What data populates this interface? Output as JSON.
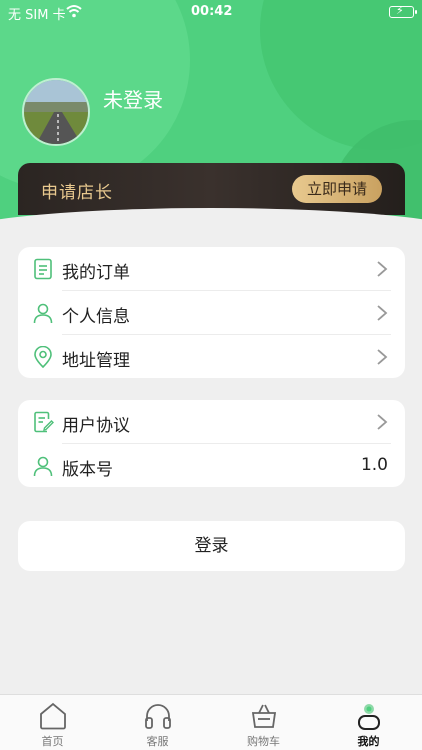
{
  "status_bar": {
    "carrier": "无 SIM 卡",
    "time": "00:42"
  },
  "profile": {
    "login_status": "未登录"
  },
  "shop_banner": {
    "title": "申请店长",
    "apply_label": "立即申请"
  },
  "menu_group_1": [
    {
      "label": "我的订单",
      "icon": "document-icon"
    },
    {
      "label": "个人信息",
      "icon": "person-icon"
    },
    {
      "label": "地址管理",
      "icon": "location-pin-icon"
    }
  ],
  "menu_group_2": [
    {
      "label": "用户协议",
      "icon": "document-edit-icon"
    },
    {
      "label": "版本号",
      "icon": "person-icon",
      "value": "1.0"
    }
  ],
  "login_button": "登录",
  "tabbar": [
    {
      "label": "首页",
      "icon": "home-icon"
    },
    {
      "label": "客服",
      "icon": "headphones-icon"
    },
    {
      "label": "购物车",
      "icon": "shopping-basket-icon"
    },
    {
      "label": "我的",
      "icon": "profile-icon",
      "active": true
    }
  ],
  "colors": {
    "brand_green": "#4fd07f",
    "gold": "#e9c98f"
  }
}
